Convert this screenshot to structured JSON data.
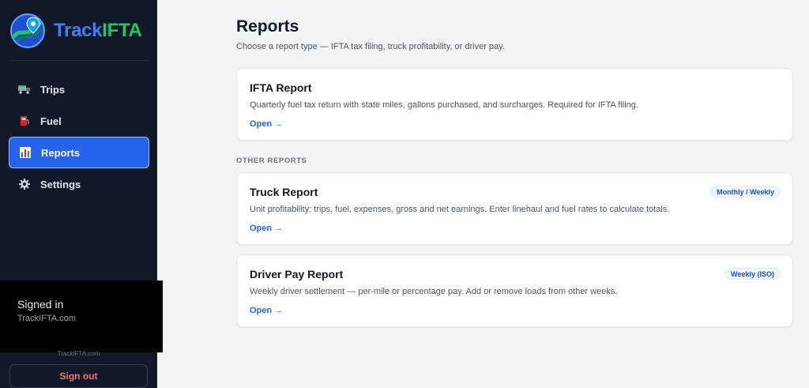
{
  "app": {
    "brand_part1": "Track",
    "brand_part2": "IFTA"
  },
  "sidebar": {
    "items": [
      {
        "label": "Trips",
        "icon": "truck-icon"
      },
      {
        "label": "Fuel",
        "icon": "fuel-pump-icon"
      },
      {
        "label": "Reports",
        "icon": "bar-chart-icon",
        "active": true
      },
      {
        "label": "Settings",
        "icon": "gear-icon"
      }
    ],
    "signed_in_title": "Signed in",
    "signed_in_sub": "TrackIFTA.com",
    "footer_site": "TrackIFTA.com",
    "sign_out": "Sign out"
  },
  "main": {
    "title": "Reports",
    "subtitle": "Choose a report type — IFTA tax filing, truck profitability, or driver pay.",
    "ifta_card": {
      "title": "IFTA Report",
      "desc": "Quarterly fuel tax return with state miles, gallons purchased, and surcharges. Required for IFTA filing.",
      "link": "Open →"
    },
    "other_label": "OTHER REPORTS",
    "truck_card": {
      "title": "Truck Report",
      "badge": "Monthly / Weekly",
      "desc": "Unit profitability: trips, fuel, expenses, gross and net earnings. Enter linehaul and fuel rates to calculate totals.",
      "link": "Open →"
    },
    "driver_card": {
      "title": "Driver Pay Report",
      "badge": "Weekly (ISO)",
      "desc": "Weekly driver settlement — per-mile or percentage pay. Add or remove loads from other weeks.",
      "link": "Open →"
    }
  },
  "colors": {
    "sidebar_bg": "#111827",
    "accent": "#2563eb",
    "brand_blue": "#3b82f6",
    "brand_green": "#22c55e",
    "sign_out": "#f87171"
  }
}
